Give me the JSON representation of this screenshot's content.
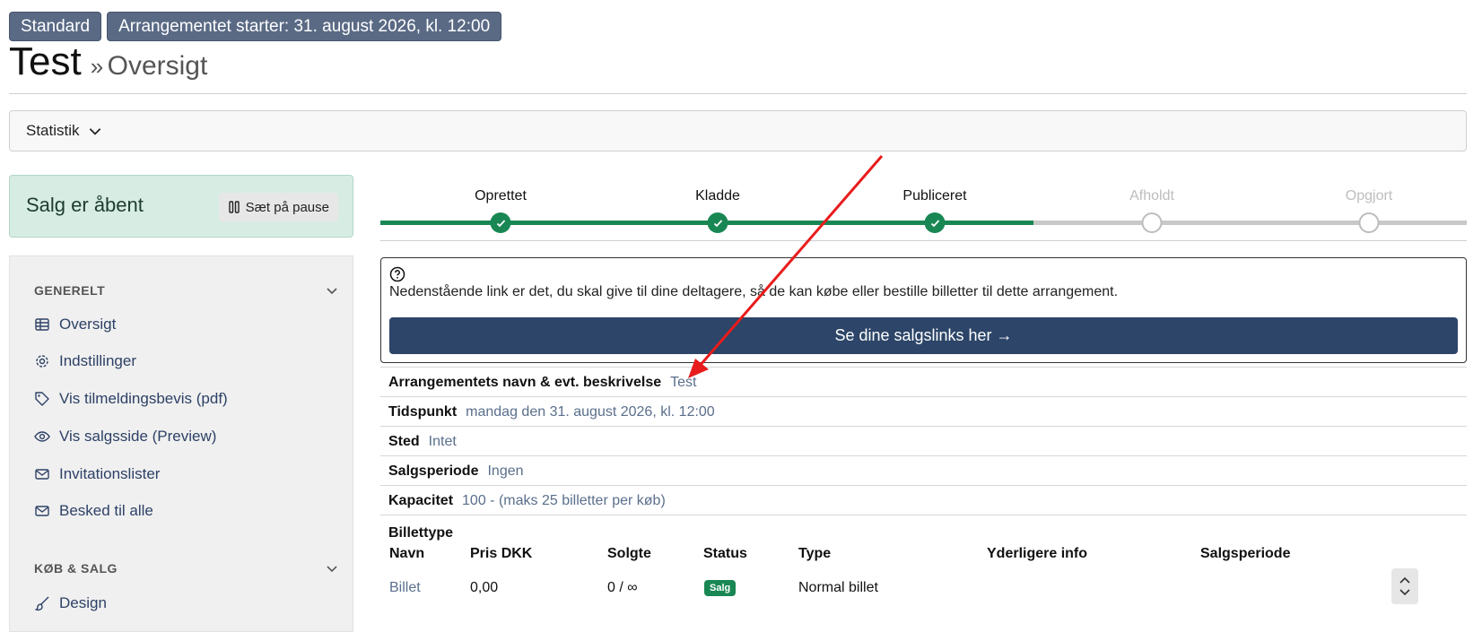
{
  "header": {
    "badges": [
      "Standard",
      "Arrangementet starter: 31. august 2026, kl. 12:00"
    ],
    "title": "Test",
    "separator": "»",
    "subtitle": "Oversigt"
  },
  "statistics": {
    "label": "Statistik"
  },
  "sales_status": {
    "text": "Salg er åbent",
    "pause_label": "Sæt på pause"
  },
  "sidebar": {
    "sections": [
      {
        "title": "GENERELT",
        "items": [
          {
            "label": "Oversigt",
            "icon": "table-icon"
          },
          {
            "label": "Indstillinger",
            "icon": "gear-icon"
          },
          {
            "label": "Vis tilmeldingsbevis (pdf)",
            "icon": "tag-icon"
          },
          {
            "label": "Vis salgsside (Preview)",
            "icon": "eye-icon"
          },
          {
            "label": "Invitationslister",
            "icon": "envelope-icon"
          },
          {
            "label": "Besked til alle",
            "icon": "envelope-icon"
          }
        ]
      },
      {
        "title": "KØB & SALG",
        "items": [
          {
            "label": "Design",
            "icon": "brush-icon"
          }
        ]
      }
    ]
  },
  "steps": [
    {
      "label": "Oprettet",
      "done": true
    },
    {
      "label": "Kladde",
      "done": true
    },
    {
      "label": "Publiceret",
      "done": true
    },
    {
      "label": "Afholdt",
      "done": false
    },
    {
      "label": "Opgjort",
      "done": false
    }
  ],
  "info": {
    "text": "Nedenstående link er det, du skal give til dine deltagere, så de kan købe eller bestille billetter til dette arrangement.",
    "button_label": "Se dine salgslinks her →"
  },
  "details": [
    {
      "key": "Arrangementets navn & evt. beskrivelse",
      "value": "Test"
    },
    {
      "key": "Tidspunkt",
      "value": "mandag den 31. august 2026, kl. 12:00"
    },
    {
      "key": "Sted",
      "value": "Intet"
    },
    {
      "key": "Salgsperiode",
      "value": "Ingen"
    },
    {
      "key": "Kapacitet",
      "value": "100 - (maks 25 billetter per køb)"
    }
  ],
  "tickets": {
    "title": "Billettype",
    "columns": [
      "Navn",
      "Pris DKK",
      "Solgte",
      "Status",
      "Type",
      "Yderligere info",
      "Salgsperiode"
    ],
    "rows": [
      {
        "navn": "Billet",
        "pris": "0,00",
        "solgte": "0 / ∞",
        "status": "Salg",
        "type": "Normal billet"
      }
    ]
  },
  "colors": {
    "accent": "#198754",
    "primary": "#2c4568",
    "annotation": "#e81c1c"
  }
}
